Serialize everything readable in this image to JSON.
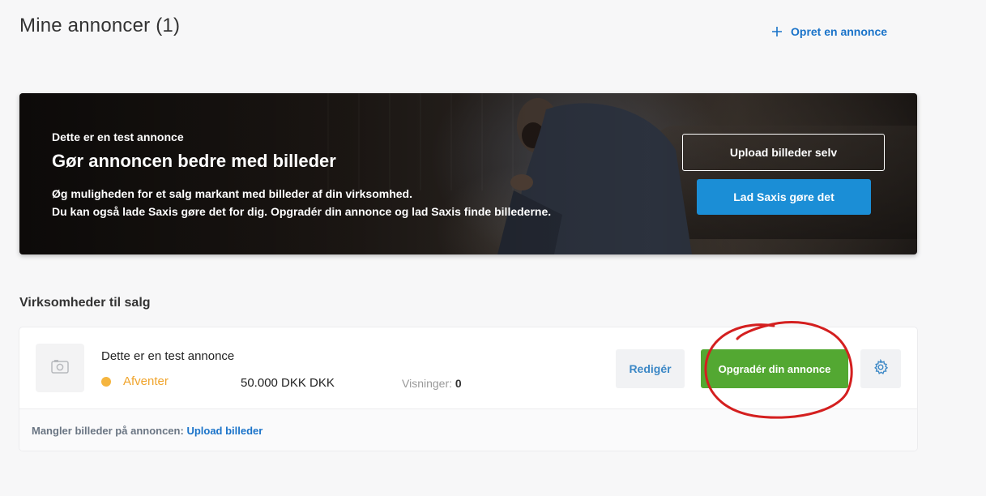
{
  "header": {
    "title": "Mine annoncer (1)",
    "create_label": "Opret en annonce"
  },
  "banner": {
    "eyebrow": "Dette er en test annonce",
    "heading": "Gør annoncen bedre med billeder",
    "text_line1": "Øg muligheden for et salg markant med billeder af din virksomhed.",
    "text_line2": "Du kan også lade Saxis gøre det for dig. Opgradér din annonce og lad Saxis finde billederne.",
    "upload_self_label": "Upload billeder selv",
    "saxis_label": "Lad Saxis gøre det"
  },
  "section": {
    "title": "Virksomheder til salg"
  },
  "listing": {
    "title": "Dette er en test annonce",
    "status": "Afventer",
    "price": "50.000 DKK DKK",
    "views_label": "Visninger:",
    "views_value": "0",
    "edit_label": "Redigér",
    "upgrade_label": "Opgradér din annonce",
    "footer_text": "Mangler billeder på annoncen:",
    "footer_link": "Upload billeder"
  },
  "colors": {
    "link_blue": "#1a73c9",
    "button_blue": "#1b8ed6",
    "upgrade_green": "#53a832",
    "status_orange": "#f5b53f",
    "annotation_red": "#d41f1f"
  },
  "icons": {
    "create": "plus-icon",
    "thumbnail": "image-placeholder-icon",
    "settings": "gear-icon"
  }
}
